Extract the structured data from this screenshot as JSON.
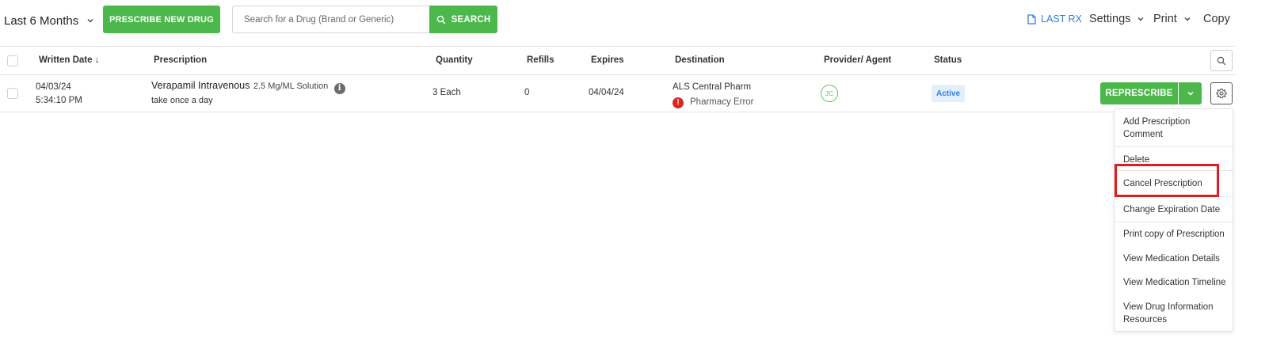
{
  "toolbar": {
    "period_label": "Last 6 Months",
    "prescribe_label": "PRESCRIBE NEW DRUG",
    "search_placeholder": "Search for a Drug (Brand or Generic)",
    "search_label": "SEARCH",
    "last_rx_label": "LAST RX",
    "settings_label": "Settings",
    "print_label": "Print",
    "copy_label": "Copy"
  },
  "table": {
    "columns": [
      "Written Date",
      "Prescription",
      "Quantity",
      "Refills",
      "Expires",
      "Destination",
      "Provider/ Agent",
      "Status"
    ],
    "sort_arrow": "↓",
    "rows": [
      {
        "written_date": "04/03/24",
        "written_time": "5:34:10 PM",
        "drug_name": "Verapamil Intravenous",
        "drug_strength": "2.5 Mg/ML Solution",
        "sig": "take once a day",
        "quantity": "3 Each",
        "refills": "0",
        "expires": "04/04/24",
        "destination": "ALS Central Pharm",
        "destination_error": "Pharmacy Error",
        "provider_initials": "JC",
        "status": "Active",
        "action_label": "REPRESCRIBE"
      }
    ]
  },
  "menu": {
    "items": [
      "Add Prescription Comment",
      "Delete",
      "Cancel Prescription",
      "Change Expiration Date",
      "Print copy of Prescription",
      "View Medication Details",
      "View Medication Timeline",
      "View Drug Information Resources"
    ]
  },
  "colors": {
    "green": "#4cb84c",
    "link_blue": "#2f7fe0",
    "error_red": "#d9281f",
    "highlight_red": "#e11b22"
  }
}
